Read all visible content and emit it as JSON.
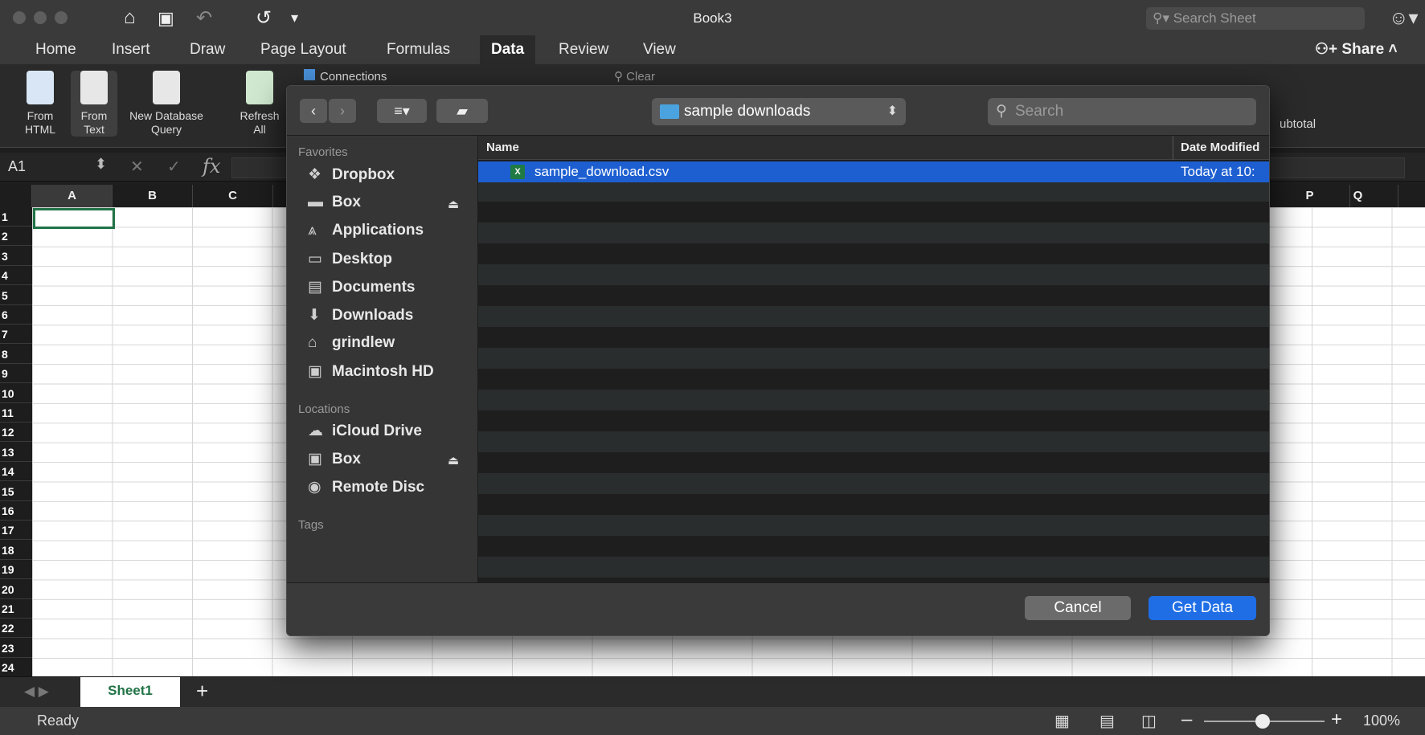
{
  "window": {
    "title": "Book3",
    "search_placeholder": "Search Sheet",
    "tabs": [
      {
        "label": "Home"
      },
      {
        "label": "Insert"
      },
      {
        "label": "Draw"
      },
      {
        "label": "Page Layout"
      },
      {
        "label": "Formulas"
      },
      {
        "label": "Data",
        "active": true
      },
      {
        "label": "Review"
      },
      {
        "label": "View"
      }
    ],
    "share_label": "Share"
  },
  "ribbon": {
    "from_html": "From\nHTML",
    "from_text": "From\nText",
    "new_db_query": "New Database\nQuery",
    "refresh_all": "Refresh\nAll",
    "connections": "Connections",
    "clear": "Clear",
    "subtotal": "ubtotal"
  },
  "formula_bar": {
    "name_box": "A1",
    "fx": "fx"
  },
  "grid": {
    "columns": [
      "A",
      "B",
      "C",
      "P",
      "Q"
    ],
    "rows": [
      "1",
      "2",
      "3",
      "4",
      "5",
      "6",
      "7",
      "8",
      "9",
      "10",
      "11",
      "12",
      "13",
      "14",
      "15",
      "16",
      "17",
      "18",
      "19",
      "20",
      "21",
      "22",
      "23",
      "24"
    ]
  },
  "sheets": {
    "tab": "Sheet1",
    "add": "+"
  },
  "status": {
    "ready": "Ready",
    "zoom": "100%"
  },
  "dialog": {
    "location": "sample downloads",
    "search_placeholder": "Search",
    "sidebar": {
      "favorites_label": "Favorites",
      "favorites": [
        {
          "icon": "dropbox-icon",
          "glyph": "❖",
          "label": "Dropbox"
        },
        {
          "icon": "folder-icon",
          "glyph": "▬",
          "label": "Box"
        },
        {
          "icon": "applications-icon",
          "glyph": "⩓",
          "label": "Applications"
        },
        {
          "icon": "desktop-icon",
          "glyph": "▭",
          "label": "Desktop"
        },
        {
          "icon": "documents-icon",
          "glyph": "▤",
          "label": "Documents"
        },
        {
          "icon": "downloads-icon",
          "glyph": "⬇",
          "label": "Downloads"
        },
        {
          "icon": "home-icon",
          "glyph": "⌂",
          "label": "grindlew"
        },
        {
          "icon": "disk-icon",
          "glyph": "▣",
          "label": "Macintosh HD"
        }
      ],
      "locations_label": "Locations",
      "locations": [
        {
          "icon": "cloud-icon",
          "glyph": "☁",
          "label": "iCloud Drive"
        },
        {
          "icon": "disk-icon",
          "glyph": "▣",
          "label": "Box"
        },
        {
          "icon": "disc-icon",
          "glyph": "◉",
          "label": "Remote Disc"
        }
      ],
      "tags_label": "Tags"
    },
    "list": {
      "col_name": "Name",
      "col_date": "Date Modified",
      "files": [
        {
          "name": "sample_download.csv",
          "date": "Today at 10:"
        }
      ]
    },
    "cancel_label": "Cancel",
    "get_data_label": "Get Data"
  }
}
